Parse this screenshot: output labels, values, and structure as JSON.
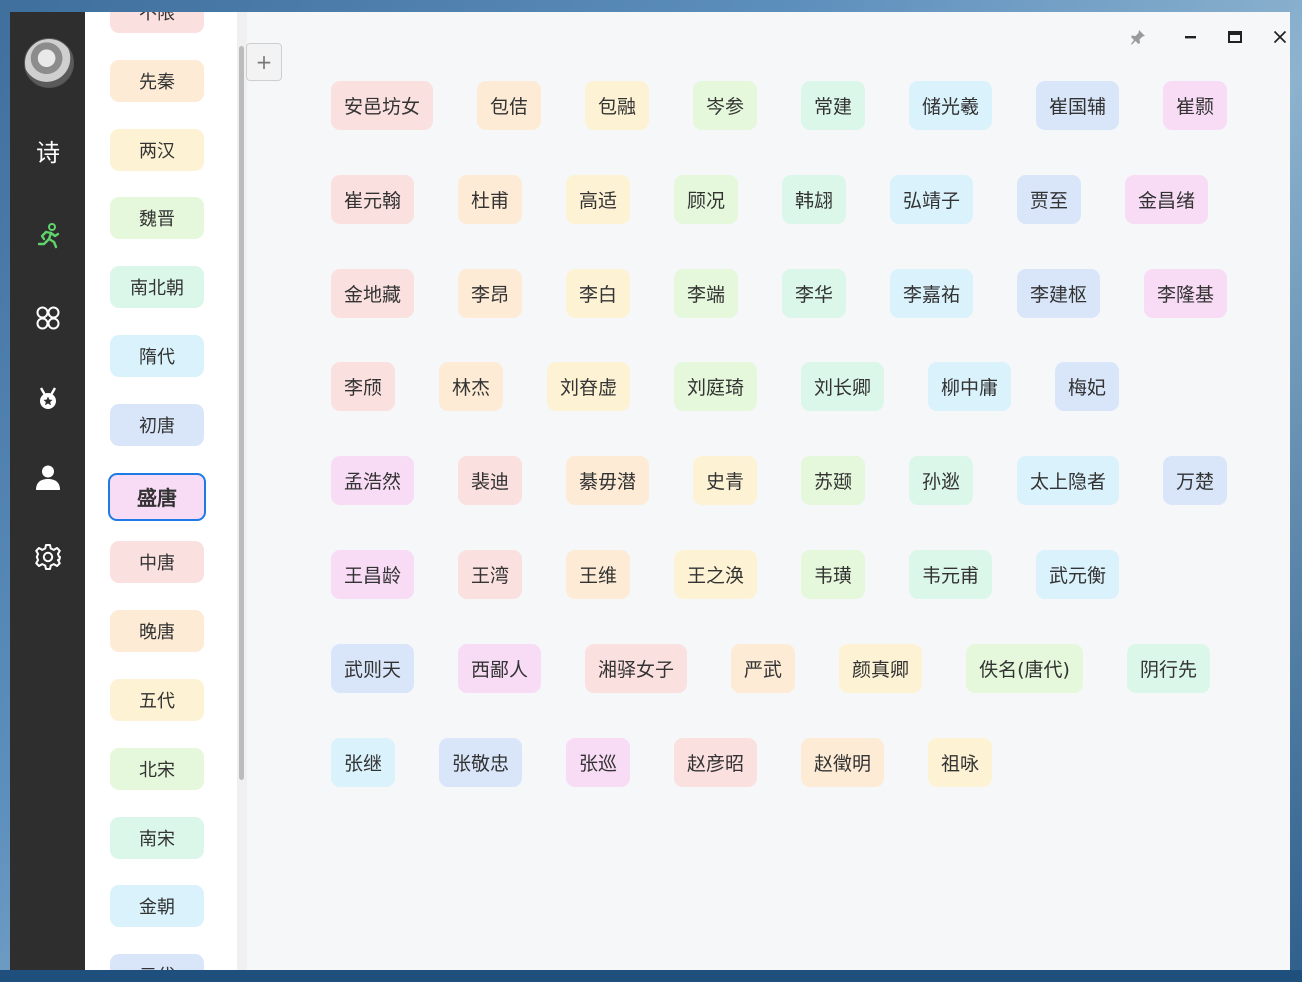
{
  "colors": {
    "pink": "#fbe0e0",
    "orange": "#fdebd6",
    "yellow": "#fdf3d4",
    "green": "#e5f8db",
    "mint": "#dbf7ea",
    "cyan": "#d9f2fb",
    "blue": "#d9e6fa",
    "violet": "#f8dcf6",
    "active_border": "#1e7be6",
    "sidebar_bg": "#2e2e2e",
    "active_nav_icon": "#5fd46a"
  },
  "sidebar": {
    "poem_label": "诗",
    "icons": [
      "avatar",
      "poem-text-icon",
      "runner-icon",
      "apps-icon",
      "medal-icon",
      "user-icon",
      "settings-icon"
    ]
  },
  "dynasties": [
    {
      "label": "不限",
      "color": "pink"
    },
    {
      "label": "先秦",
      "color": "orange"
    },
    {
      "label": "两汉",
      "color": "yellow"
    },
    {
      "label": "魏晋",
      "color": "green"
    },
    {
      "label": "南北朝",
      "color": "mint"
    },
    {
      "label": "隋代",
      "color": "cyan"
    },
    {
      "label": "初唐",
      "color": "blue"
    },
    {
      "label": "盛唐",
      "color": "violet",
      "active": true
    },
    {
      "label": "中唐",
      "color": "pink"
    },
    {
      "label": "晚唐",
      "color": "orange"
    },
    {
      "label": "五代",
      "color": "yellow"
    },
    {
      "label": "北宋",
      "color": "green"
    },
    {
      "label": "南宋",
      "color": "mint"
    },
    {
      "label": "金朝",
      "color": "cyan"
    },
    {
      "label": "元代",
      "color": "blue"
    }
  ],
  "toolbar": {
    "add_label": "+",
    "pin_icon": "pin-icon",
    "minimize_icon": "minimize-icon",
    "maximize_icon": "maximize-icon",
    "close_icon": "close-icon"
  },
  "poet_rows": [
    [
      {
        "name": "安邑坊女",
        "color": "pink"
      },
      {
        "name": "包佶",
        "color": "orange"
      },
      {
        "name": "包融",
        "color": "yellow"
      },
      {
        "name": "岑参",
        "color": "green"
      },
      {
        "name": "常建",
        "color": "mint"
      },
      {
        "name": "储光羲",
        "color": "cyan"
      },
      {
        "name": "崔国辅",
        "color": "blue"
      },
      {
        "name": "崔颢",
        "color": "violet"
      }
    ],
    [
      {
        "name": "崔元翰",
        "color": "pink"
      },
      {
        "name": "杜甫",
        "color": "orange"
      },
      {
        "name": "高适",
        "color": "yellow"
      },
      {
        "name": "顾况",
        "color": "green"
      },
      {
        "name": "韩翃",
        "color": "mint"
      },
      {
        "name": "弘靖子",
        "color": "cyan"
      },
      {
        "name": "贾至",
        "color": "blue"
      },
      {
        "name": "金昌绪",
        "color": "violet"
      }
    ],
    [
      {
        "name": "金地藏",
        "color": "pink"
      },
      {
        "name": "李昂",
        "color": "orange"
      },
      {
        "name": "李白",
        "color": "yellow"
      },
      {
        "name": "李端",
        "color": "green"
      },
      {
        "name": "李华",
        "color": "mint"
      },
      {
        "name": "李嘉祐",
        "color": "cyan"
      },
      {
        "name": "李建枢",
        "color": "blue"
      },
      {
        "name": "李隆基",
        "color": "violet"
      }
    ],
    [
      {
        "name": "李颀",
        "color": "pink"
      },
      {
        "name": "林杰",
        "color": "orange"
      },
      {
        "name": "刘昚虚",
        "color": "yellow"
      },
      {
        "name": "刘庭琦",
        "color": "green"
      },
      {
        "name": "刘长卿",
        "color": "mint"
      },
      {
        "name": "柳中庸",
        "color": "cyan"
      },
      {
        "name": "梅妃",
        "color": "blue"
      }
    ],
    [
      {
        "name": "孟浩然",
        "color": "violet"
      },
      {
        "name": "裴迪",
        "color": "pink"
      },
      {
        "name": "綦毋潜",
        "color": "orange"
      },
      {
        "name": "史青",
        "color": "yellow"
      },
      {
        "name": "苏颋",
        "color": "green"
      },
      {
        "name": "孙逖",
        "color": "mint"
      },
      {
        "name": "太上隐者",
        "color": "cyan"
      },
      {
        "name": "万楚",
        "color": "blue"
      }
    ],
    [
      {
        "name": "王昌龄",
        "color": "violet"
      },
      {
        "name": "王湾",
        "color": "pink"
      },
      {
        "name": "王维",
        "color": "orange"
      },
      {
        "name": "王之涣",
        "color": "yellow"
      },
      {
        "name": "韦璜",
        "color": "green"
      },
      {
        "name": "韦元甫",
        "color": "mint"
      },
      {
        "name": "武元衡",
        "color": "cyan"
      }
    ],
    [
      {
        "name": "武则天",
        "color": "blue"
      },
      {
        "name": "西鄙人",
        "color": "violet"
      },
      {
        "name": "湘驿女子",
        "color": "pink"
      },
      {
        "name": "严武",
        "color": "orange"
      },
      {
        "name": "颜真卿",
        "color": "yellow"
      },
      {
        "name": "佚名(唐代)",
        "color": "green"
      },
      {
        "name": "阴行先",
        "color": "mint"
      }
    ],
    [
      {
        "name": "张继",
        "color": "cyan"
      },
      {
        "name": "张敬忠",
        "color": "blue"
      },
      {
        "name": "张巡",
        "color": "violet"
      },
      {
        "name": "赵彦昭",
        "color": "pink"
      },
      {
        "name": "赵徵明",
        "color": "orange"
      },
      {
        "name": "祖咏",
        "color": "yellow"
      }
    ]
  ]
}
